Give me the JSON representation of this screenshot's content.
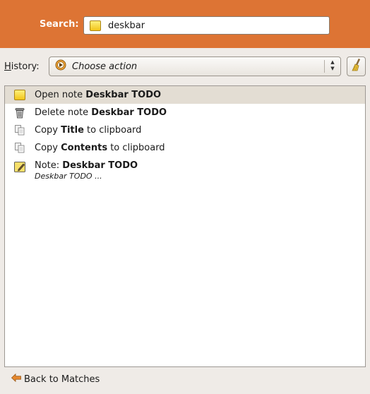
{
  "search": {
    "label": "Search:",
    "value": "deskbar"
  },
  "history": {
    "label_underlined": "H",
    "label_rest": "istory:",
    "combo_text": "Choose action"
  },
  "actions": [
    {
      "icon": "note-icon",
      "prefix": "Open note ",
      "bold": "Deskbar TODO",
      "suffix": ""
    },
    {
      "icon": "trash-icon",
      "prefix": "Delete note ",
      "bold": "Deskbar TODO",
      "suffix": ""
    },
    {
      "icon": "copy-icon",
      "prefix": "Copy ",
      "bold": "Title",
      "suffix": " to clipboard"
    },
    {
      "icon": "copy-icon",
      "prefix": "Copy ",
      "bold": "Contents",
      "suffix": " to clipboard"
    }
  ],
  "note_result": {
    "prefix": "Note: ",
    "bold": "Deskbar TODO",
    "subtitle": "Deskbar TODO ..."
  },
  "footer": {
    "back_label": "Back to Matches"
  },
  "colors": {
    "search_bar": "#dd7434",
    "selected_row": "#e3ddd3",
    "note_yellow": "#f2c51a",
    "back_arrow": "#e8892e"
  }
}
